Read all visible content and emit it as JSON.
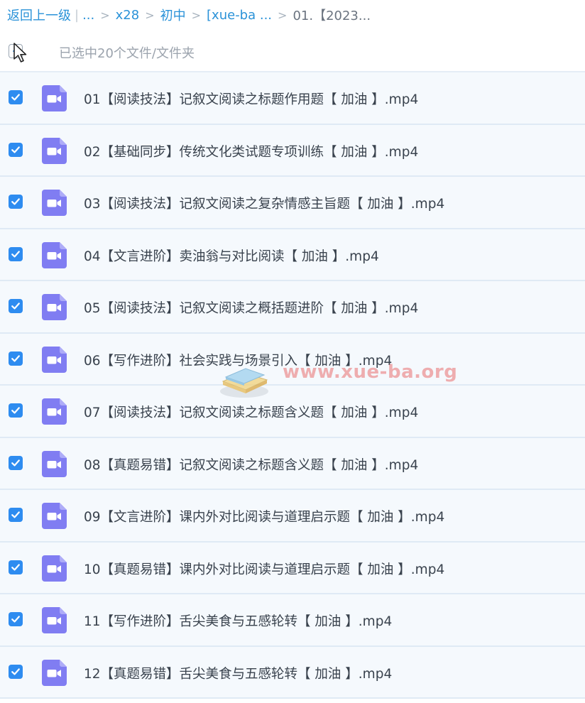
{
  "breadcrumb": {
    "back": "返回上一级",
    "separator": "|",
    "ellipsis": "...",
    "arrow": ">",
    "items": [
      "x28",
      "初中",
      "[xue-ba ..."
    ],
    "current": "01.【2023..."
  },
  "selection": {
    "summary": "已选中20个文件/文件夹"
  },
  "files": [
    {
      "name": "01【阅读技法】记叙文阅读之标题作用题【 加油 】.mp4",
      "checked": true
    },
    {
      "name": "02【基础同步】传统文化类试题专项训练【 加油 】.mp4",
      "checked": true
    },
    {
      "name": "03【阅读技法】记叙文阅读之复杂情感主旨题【 加油 】.mp4",
      "checked": true
    },
    {
      "name": "04【文言进阶】卖油翁与对比阅读【 加油 】.mp4",
      "checked": true
    },
    {
      "name": "05【阅读技法】记叙文阅读之概括题进阶【 加油 】.mp4",
      "checked": true
    },
    {
      "name": "06【写作进阶】社会实践与场景引入【 加油 】.mp4",
      "checked": true
    },
    {
      "name": "07【阅读技法】记叙文阅读之标题含义题【 加油 】.mp4",
      "checked": true
    },
    {
      "name": "08【真题易错】记叙文阅读之标题含义题【 加油 】.mp4",
      "checked": true
    },
    {
      "name": "09【文言进阶】课内外对比阅读与道理启示题【 加油 】.mp4",
      "checked": true
    },
    {
      "name": "10【真题易错】课内外对比阅读与道理启示题【 加油 】.mp4",
      "checked": true
    },
    {
      "name": "11【写作进阶】舌尖美食与五感轮转【 加油 】.mp4",
      "checked": true
    },
    {
      "name": "12【真题易错】舌尖美食与五感轮转【 加油 】.mp4",
      "checked": true
    }
  ],
  "watermark": "www.xue-ba.org",
  "icons": {
    "file": "video-file-icon",
    "checkbox": "check-icon",
    "cursor": "mouse-cursor-icon"
  },
  "colors": {
    "link": "#2a92d8",
    "checkbox": "#2e8cf0",
    "file_icon": "#7f7cf0",
    "row_bg": "#f5f9fd",
    "watermark": "#e87070"
  }
}
